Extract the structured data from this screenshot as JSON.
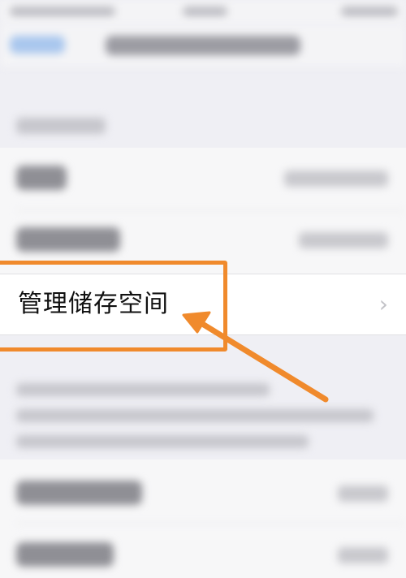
{
  "colors": {
    "annotation": "#f08a2c",
    "background": "#efeff4",
    "row": "#ffffff"
  },
  "manage_storage": {
    "label": "管理储存空间",
    "chevron": "›",
    "icon": "chevron-right-icon"
  },
  "annotation": {
    "icon": "arrow-icon"
  }
}
